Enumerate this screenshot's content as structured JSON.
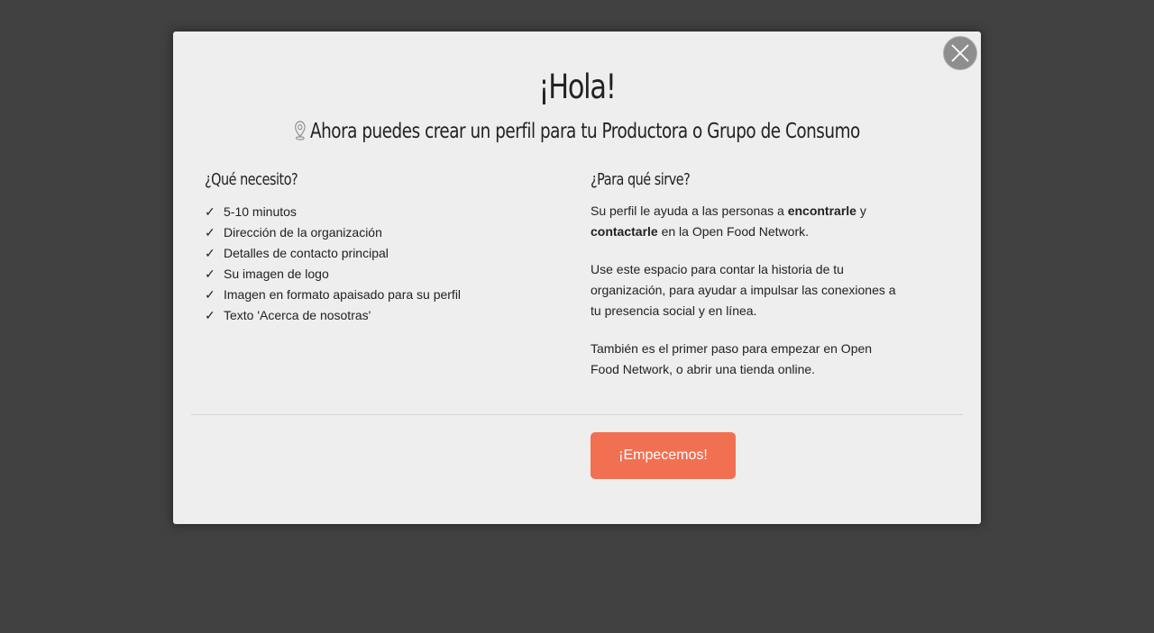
{
  "modal": {
    "title": "¡Hola!",
    "subtitle": "Ahora puedes crear un perfil para tu Productora o Grupo de Consumo",
    "subtitle_icon": "map-pin-icon",
    "close_icon": "close-icon",
    "left_heading": "¿Qué necesito?",
    "needs": [
      "5-10 minutos",
      "Dirección de la organización",
      "Detalles de contacto principal",
      "Su imagen de logo",
      "Imagen en formato apaisado para su perfil",
      "Texto 'Acerca de nosotras'"
    ],
    "check_mark": "✓",
    "right_heading": "¿Para qué sirve?",
    "p1": {
      "t1": "Su perfil le ayuda a las personas a ",
      "b1": "encontrarle",
      "t2": " y ",
      "b2": "contactarle",
      "t3": " en la Open Food Network."
    },
    "p2": "Use este espacio para contar la historia de tu organización, para ayudar a impulsar las conexiones a tu presencia social y en línea.",
    "p3": "También es el primer paso para empezar en Open Food Network, o abrir una tienda online.",
    "start_button": "¡Empecemos!"
  },
  "colors": {
    "overlay": "#414141",
    "modal_bg": "#eeeeee",
    "accent": "#f27052",
    "close_bg": "#8e8e8e"
  }
}
